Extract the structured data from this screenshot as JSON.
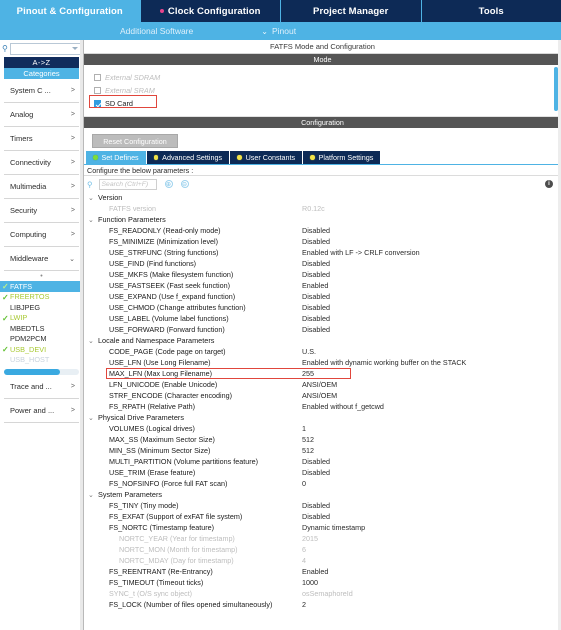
{
  "topbar": {
    "tabs": [
      {
        "label": "Pinout & Configuration",
        "active": true,
        "dot": false
      },
      {
        "label": "Clock Configuration",
        "active": false,
        "dot": true
      },
      {
        "label": "Project Manager",
        "active": false,
        "dot": false
      },
      {
        "label": "Tools",
        "active": false,
        "dot": false
      }
    ]
  },
  "subbar": {
    "additional_software": "Additional Software",
    "pinout": "Pinout",
    "chevron": "⌄"
  },
  "sidebar": {
    "search_placeholder": "",
    "az_label": "A->Z",
    "categories_label": "Categories",
    "groups": [
      {
        "label": "System C ...",
        "arrow": ">"
      },
      {
        "label": "Analog",
        "arrow": ">"
      },
      {
        "label": "Timers",
        "arrow": ">"
      },
      {
        "label": "Connectivity",
        "arrow": ">"
      },
      {
        "label": "Multimedia",
        "arrow": ">"
      },
      {
        "label": "Security",
        "arrow": ">"
      },
      {
        "label": "Computing",
        "arrow": ">"
      },
      {
        "label": "Middleware",
        "arrow": "⌄"
      }
    ],
    "middleware_items": [
      {
        "label": "FATFS",
        "check": true,
        "state": "selected"
      },
      {
        "label": "FREERTOS",
        "check": true,
        "state": "green"
      },
      {
        "label": "LIBJPEG",
        "check": false,
        "state": "normal"
      },
      {
        "label": "LWIP",
        "check": true,
        "state": "green"
      },
      {
        "label": "MBEDTLS",
        "check": false,
        "state": "normal"
      },
      {
        "label": "PDM2PCM",
        "check": false,
        "state": "normal"
      },
      {
        "label": "USB_DEVI",
        "check": true,
        "state": "green"
      },
      {
        "label": "USB_HOST",
        "check": false,
        "state": "dim"
      }
    ],
    "bottom_groups": [
      {
        "label": "Trace and ...",
        "arrow": ">"
      },
      {
        "label": "Power and ...",
        "arrow": ">"
      }
    ]
  },
  "main": {
    "title": "FATFS Mode and Configuration",
    "mode_band": "Mode",
    "configuration_band": "Configuration",
    "mode_options": [
      {
        "label": "External SDRAM",
        "checked": false,
        "disabled": true
      },
      {
        "label": "External SRAM",
        "checked": false,
        "disabled": true
      },
      {
        "label": "SD Card",
        "checked": true,
        "disabled": false
      }
    ],
    "reset_button": "Reset Configuration",
    "config_tabs": [
      {
        "label": "Set Defines",
        "active": true,
        "led": "green"
      },
      {
        "label": "Advanced Settings",
        "active": false,
        "led": "yellow"
      },
      {
        "label": "User Constants",
        "active": false,
        "led": "yellow"
      },
      {
        "label": "Platform Settings",
        "active": false,
        "led": "yellow"
      }
    ],
    "hint": "Configure the below parameters :",
    "search_placeholder": "Search (Ctrl+F)",
    "info_icon": "i",
    "circle_icons": [
      "↑",
      "↓"
    ]
  },
  "colors": {
    "accent_blue": "#4eb3e4",
    "navy": "#0d2a56",
    "band_grey": "#555555",
    "highlight_red": "#e0463c",
    "led_green": "#7ddc3a",
    "led_yellow": "#f0e24a"
  },
  "parameters": [
    {
      "type": "group",
      "label": "Version"
    },
    {
      "type": "param",
      "name": "FATFS version",
      "value": "R0.12c",
      "disabled": true
    },
    {
      "type": "group",
      "label": "Function Parameters"
    },
    {
      "type": "param",
      "name": "FS_READONLY (Read-only mode)",
      "value": "Disabled"
    },
    {
      "type": "param",
      "name": "FS_MINIMIZE (Minimization level)",
      "value": "Disabled"
    },
    {
      "type": "param",
      "name": "USE_STRFUNC (String functions)",
      "value": "Enabled with LF -> CRLF conversion"
    },
    {
      "type": "param",
      "name": "USE_FIND (Find functions)",
      "value": "Disabled"
    },
    {
      "type": "param",
      "name": "USE_MKFS (Make filesystem function)",
      "value": "Disabled"
    },
    {
      "type": "param",
      "name": "USE_FASTSEEK (Fast seek function)",
      "value": "Enabled"
    },
    {
      "type": "param",
      "name": "USE_EXPAND (Use f_expand function)",
      "value": "Disabled"
    },
    {
      "type": "param",
      "name": "USE_CHMOD (Change attributes function)",
      "value": "Disabled"
    },
    {
      "type": "param",
      "name": "USE_LABEL (Volume label functions)",
      "value": "Disabled"
    },
    {
      "type": "param",
      "name": "USE_FORWARD (Forward function)",
      "value": "Disabled"
    },
    {
      "type": "group",
      "label": "Locale and Namespace Parameters"
    },
    {
      "type": "param",
      "name": "CODE_PAGE (Code page on target)",
      "value": "U.S."
    },
    {
      "type": "param",
      "name": "USE_LFN (Use Long Filename)",
      "value": "Enabled with dynamic working buffer on the STACK"
    },
    {
      "type": "param",
      "name": "MAX_LFN (Max Long Filename)",
      "value": "255",
      "highlight": true
    },
    {
      "type": "param",
      "name": "LFN_UNICODE (Enable Unicode)",
      "value": "ANSI/OEM"
    },
    {
      "type": "param",
      "name": "STRF_ENCODE (Character encoding)",
      "value": "ANSI/OEM"
    },
    {
      "type": "param",
      "name": "FS_RPATH (Relative Path)",
      "value": "Enabled without f_getcwd"
    },
    {
      "type": "group",
      "label": "Physical Drive Parameters"
    },
    {
      "type": "param",
      "name": "VOLUMES (Logical drives)",
      "value": "1"
    },
    {
      "type": "param",
      "name": "MAX_SS (Maximum Sector Size)",
      "value": "512"
    },
    {
      "type": "param",
      "name": "MIN_SS (Minimum Sector Size)",
      "value": "512"
    },
    {
      "type": "param",
      "name": "MULTI_PARTITION (Volume partitions feature)",
      "value": "Disabled"
    },
    {
      "type": "param",
      "name": "USE_TRIM (Erase feature)",
      "value": "Disabled"
    },
    {
      "type": "param",
      "name": "FS_NOFSINFO (Force full FAT scan)",
      "value": "0"
    },
    {
      "type": "group",
      "label": "System Parameters"
    },
    {
      "type": "param",
      "name": "FS_TINY (Tiny mode)",
      "value": "Disabled"
    },
    {
      "type": "param",
      "name": "FS_EXFAT (Support of exFAT file system)",
      "value": "Disabled"
    },
    {
      "type": "param",
      "name": "FS_NORTC (Timestamp feature)",
      "value": "Dynamic timestamp"
    },
    {
      "type": "param",
      "name": "NORTC_YEAR (Year for timestamp)",
      "value": "2015",
      "disabled": true,
      "sub": true
    },
    {
      "type": "param",
      "name": "NORTC_MON (Month for timestamp)",
      "value": "6",
      "disabled": true,
      "sub": true
    },
    {
      "type": "param",
      "name": "NORTC_MDAY (Day for timestamp)",
      "value": "4",
      "disabled": true,
      "sub": true
    },
    {
      "type": "param",
      "name": "FS_REENTRANT (Re-Entrancy)",
      "value": "Enabled"
    },
    {
      "type": "param",
      "name": "FS_TIMEOUT (Timeout ticks)",
      "value": "1000"
    },
    {
      "type": "param",
      "name": "SYNC_t (O/S sync object)",
      "value": "osSemaphoreId",
      "disabled": true
    },
    {
      "type": "param",
      "name": "FS_LOCK (Number of files opened simultaneously)",
      "value": "2"
    }
  ]
}
